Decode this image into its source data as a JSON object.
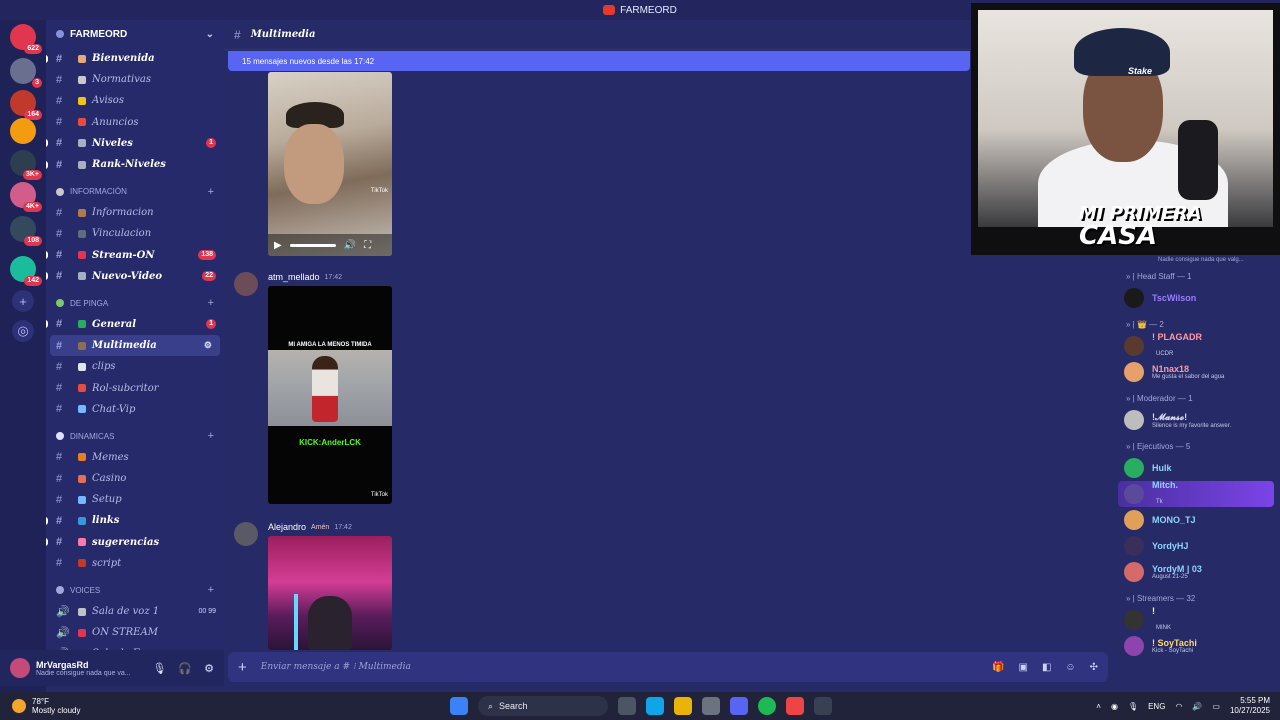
{
  "titlebar": {
    "title": "FARMEORD"
  },
  "rail": {
    "servers": [
      {
        "color": "#e0364f",
        "badge": "622"
      },
      {
        "color": "#6b6f8f",
        "badge": "3"
      },
      {
        "color": "#c0392b",
        "badge": "164"
      },
      {
        "color": "#f39c12",
        "badge": ""
      },
      {
        "color": "#2c3e50",
        "badge": "3K+"
      },
      {
        "color": "#d35d8a",
        "badge": "4K+"
      },
      {
        "color": "#34495e",
        "badge": "108"
      },
      {
        "color": "#1abc9c",
        "badge": "142"
      }
    ]
  },
  "server": {
    "name": "FARMEORD"
  },
  "channels_top": [
    {
      "name": "Bienvenida",
      "color": "#e8a87c",
      "bold": true
    },
    {
      "name": "Normativas",
      "color": "#c9c9c9",
      "bold": false
    },
    {
      "name": "Avisos",
      "color": "#f1c40f",
      "bold": false
    },
    {
      "name": "Anuncios",
      "color": "#e74c3c",
      "bold": false
    },
    {
      "name": "Niveles",
      "color": "#a5b1c2",
      "bold": true,
      "badge": "1"
    },
    {
      "name": "Rank-Niveles",
      "color": "#a5b1c2",
      "bold": true
    }
  ],
  "cat_info": {
    "label": "INFORMACIÓN"
  },
  "channels_info": [
    {
      "name": "Informacion",
      "color": "#b07a4f",
      "bold": false
    },
    {
      "name": "Vinculacion",
      "color": "#5d6d7e",
      "bold": false
    },
    {
      "name": "Stream-ON",
      "color": "#e0364f",
      "bold": true,
      "badge": "138"
    },
    {
      "name": "Nuevo-Video",
      "color": "#a5b1c2",
      "bold": true,
      "badge": "22"
    }
  ],
  "cat_pinga": {
    "label": "DE PINGA"
  },
  "channels_pinga": [
    {
      "name": "General",
      "color": "#27ae60",
      "bold": true,
      "badge": "1"
    },
    {
      "name": "Multimedia",
      "color": "#8e6e53",
      "bold": true,
      "active": true,
      "tools": "⚙"
    },
    {
      "name": "clips",
      "color": "#dfe6e9",
      "bold": false
    },
    {
      "name": "Rol-subcritor",
      "color": "#e74c3c",
      "bold": false
    },
    {
      "name": "Chat-Vip",
      "color": "#74b9ff",
      "bold": false
    }
  ],
  "cat_din": {
    "label": "DINAMICAS"
  },
  "channels_din": [
    {
      "name": "Memes",
      "color": "#e67e22",
      "bold": false
    },
    {
      "name": "Casino",
      "color": "#e17055",
      "bold": false
    },
    {
      "name": "Setup",
      "color": "#74b9ff",
      "bold": false
    },
    {
      "name": "links",
      "color": "#3498db",
      "bold": true
    },
    {
      "name": "sugerencias",
      "color": "#fd79a8",
      "bold": true
    },
    {
      "name": "script",
      "color": "#c0392b",
      "bold": false
    }
  ],
  "cat_voice": {
    "label": "VOICES"
  },
  "channels_voice": [
    {
      "name": "Sala de voz 1",
      "color": "#bdc3c7",
      "count": "00  99"
    },
    {
      "name": "ON STREAM",
      "color": "#e0364f"
    },
    {
      "name": "Sala de Espera",
      "color": "#f1c40f"
    }
  ],
  "user": {
    "name": "MrVargasRd",
    "status": "Nadie consigue nada que va..."
  },
  "chat": {
    "channel": "Multimedia",
    "banner": "15 mensajes nuevos desde las 17:42",
    "tiktok": "TikTok",
    "msg2_author": "atm_mellado",
    "msg2_time": "17:42",
    "msg2_caption": "MI AMIGA LA MENOS TIMIDA",
    "msg2_kick": "KICK:AnderLCK",
    "msg3_author": "Alejandro",
    "msg3_role": "Amén",
    "msg3_time": "17:42",
    "composer_placeholder": "Enviar mensaje a # ⁝ Multimedia"
  },
  "cam": {
    "brand": "Stake",
    "logo_line1": "MI PRIMERA",
    "logo_line2": "CASA"
  },
  "members": {
    "status_top": "Nadie consigue nada que valg...",
    "cats": [
      {
        "label": "» | Head Staff — 1"
      },
      {
        "label": "» | 👑 — 2"
      },
      {
        "label": "» | Moderador — 1"
      },
      {
        "label": "» | Ejecutivos — 5"
      },
      {
        "label": "» | Streamers — 32"
      }
    ],
    "head_staff": [
      {
        "name": "TscWilson",
        "color": "#9a7cff",
        "av": "#1a1a1a"
      }
    ],
    "crown": [
      {
        "name": "! PLAGADR",
        "color": "#ff9aa2",
        "av": "#5a3a2e",
        "sub": "",
        "tag": "UCDR"
      },
      {
        "name": "N1nax18",
        "color": "#ff9aa2",
        "av": "#e8a06a",
        "sub": "Me gusta el sabor del agua"
      }
    ],
    "mods": [
      {
        "name": "!𝓜𝓪𝓷𝓼𝓸!",
        "color": "#d9d9f0",
        "av": "#bdbdbd",
        "sub": "Silence is my favorite answer."
      }
    ],
    "execs": [
      {
        "name": "Hulk",
        "color": "#8fd3ff",
        "av": "#27ae60"
      },
      {
        "name": "Mitch.",
        "color": "#8fd3ff",
        "av": "#5b4a9a",
        "highlight": true,
        "tag": "Tk"
      },
      {
        "name": "MONO_TJ",
        "color": "#8fd3ff",
        "av": "#e0a05a"
      },
      {
        "name": "YordyHJ",
        "color": "#8fd3ff",
        "av": "#3a2e5a"
      },
      {
        "name": "YordyM | 03",
        "color": "#8fd3ff",
        "av": "#d46a6a",
        "sub": "August 21-25"
      }
    ],
    "streamers": [
      {
        "name": "!",
        "color": "#ffffff",
        "av": "#333",
        "tag": "MINK"
      },
      {
        "name": "! SoyTachi",
        "color": "#ffd86e",
        "av": "#8e44ad",
        "sub": "Kick - SoyTachi"
      }
    ]
  },
  "taskbar": {
    "temp": "78°F",
    "weather": "Mostly cloudy",
    "search": "Search",
    "lang": "ENG",
    "time": "5:55 PM",
    "date": "10/27/2025"
  }
}
